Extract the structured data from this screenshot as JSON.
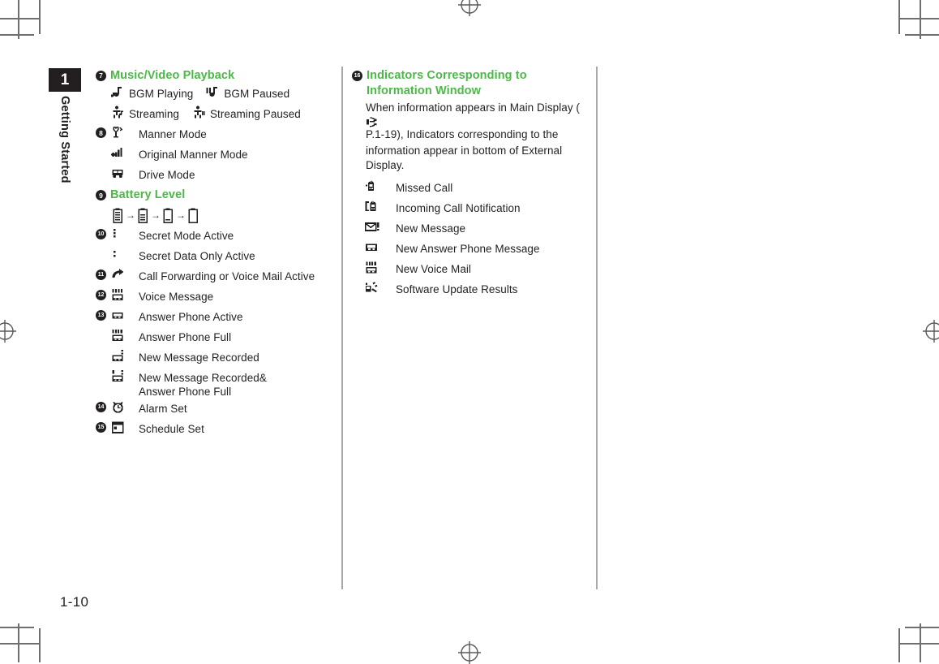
{
  "page": {
    "folio": "1-10",
    "chapter_number": "1",
    "chapter_title": "Getting Started",
    "accent_color": "#4cb848",
    "ink_color": "#231f20",
    "rule_color": "#a7a9ac"
  },
  "left_column": {
    "sections": [
      {
        "bullet": "7",
        "heading": "Music/Video Playback",
        "entries": [
          {
            "icon": "bgm-playing-icon",
            "label": "BGM Playing",
            "icon2": "bgm-paused-icon",
            "label2": "BGM Paused"
          },
          {
            "icon": "streaming-icon",
            "label": "Streaming",
            "icon2": "streaming-paused-icon",
            "label2": "Streaming Paused"
          }
        ]
      },
      {
        "bullet": "8",
        "heading": "",
        "entries": [
          {
            "icon": "manner-mode-icon",
            "label": "Manner Mode"
          },
          {
            "icon": "original-manner-mode-icon",
            "label": "Original Manner Mode"
          },
          {
            "icon": "drive-mode-icon",
            "label": "Drive Mode"
          }
        ]
      },
      {
        "bullet": "9",
        "heading": "Battery Level",
        "battery": {
          "arrow": "→",
          "levels": [
            "battery-full-icon",
            "battery-two-thirds-icon",
            "battery-one-third-icon",
            "battery-empty-icon"
          ]
        }
      },
      {
        "bullet": "10",
        "heading": "",
        "entries": [
          {
            "icon": "secret-mode-active-icon",
            "label": "Secret Mode Active"
          },
          {
            "icon": "secret-data-only-active-icon",
            "label": "Secret Data Only Active"
          }
        ]
      },
      {
        "bullet": "11",
        "heading": "",
        "entries": [
          {
            "icon": "call-forwarding-icon",
            "label": "Call Forwarding or Voice Mail Active"
          }
        ]
      },
      {
        "bullet": "12",
        "heading": "",
        "entries": [
          {
            "icon": "voice-message-icon",
            "label": "Voice Message"
          }
        ]
      },
      {
        "bullet": "13",
        "heading": "",
        "entries": [
          {
            "icon": "answer-phone-active-icon",
            "label": "Answer Phone Active"
          },
          {
            "icon": "answer-phone-full-icon",
            "label": "Answer Phone Full"
          },
          {
            "icon": "new-message-recorded-icon",
            "label": "New Message Recorded"
          },
          {
            "icon": "new-message-recorded-and-full-icon",
            "label": "New Message Recorded&\nAnswer Phone Full"
          }
        ]
      },
      {
        "bullet": "14",
        "heading": "",
        "entries": [
          {
            "icon": "alarm-set-icon",
            "label": "Alarm Set"
          }
        ]
      },
      {
        "bullet": "15",
        "heading": "",
        "entries": [
          {
            "icon": "schedule-set-icon",
            "label": "Schedule Set"
          }
        ]
      }
    ]
  },
  "right_column": {
    "bullet": "16",
    "heading": "Indicators Corresponding to Information Window",
    "body_before_ref": "When information appears in Main Display (",
    "reference_icon": "pointing-hand-icon",
    "reference_target": "P.1-19",
    "body_after_ref": "), Indicators corresponding to the information appear in bottom of External Display.",
    "entries": [
      {
        "icon": "missed-call-icon",
        "label": "Missed Call"
      },
      {
        "icon": "incoming-call-notification-icon",
        "label": "Incoming Call Notification"
      },
      {
        "icon": "new-message-icon",
        "label": "New Message"
      },
      {
        "icon": "new-answer-phone-message-icon",
        "label": "New Answer Phone Message"
      },
      {
        "icon": "new-voice-mail-icon",
        "label": "New Voice Mail"
      },
      {
        "icon": "software-update-results-icon",
        "label": "Software Update Results"
      }
    ]
  }
}
